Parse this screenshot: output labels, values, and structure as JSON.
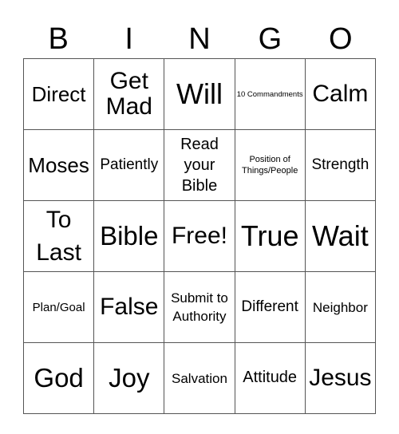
{
  "header": [
    "B",
    "I",
    "N",
    "G",
    "O"
  ],
  "rows": [
    [
      "Direct",
      "Get Mad",
      "Will",
      "10 Commandments",
      "Calm"
    ],
    [
      "Moses",
      "Patiently",
      "Read your Bible",
      "Position of Things/People",
      "Strength"
    ],
    [
      "To Last",
      "Bible",
      "Free!",
      "True",
      "Wait"
    ],
    [
      "Plan/Goal",
      "False",
      "Submit to Authority",
      "Different",
      "Neighbor"
    ],
    [
      "God",
      "Joy",
      "Salvation",
      "Attitude",
      "Jesus"
    ]
  ]
}
